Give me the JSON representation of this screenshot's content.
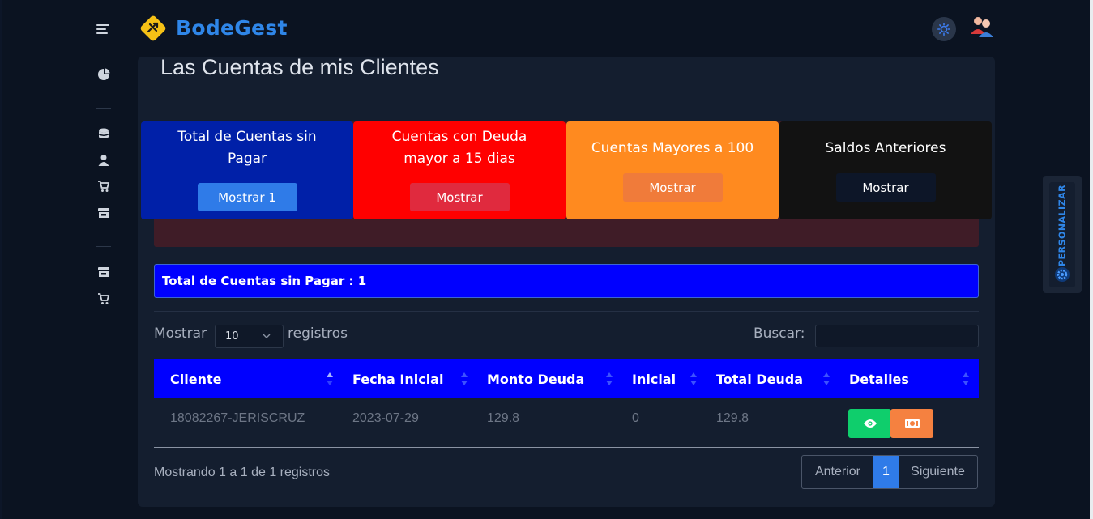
{
  "app": {
    "brand": "BodeGest"
  },
  "page": {
    "title": "Las Cuentas de mis Clientes"
  },
  "stats": [
    {
      "title": "Total de Cuentas sin Pagar",
      "button": "Mostrar 1",
      "bg": "#0020a8",
      "btn_bg": "#2f7be8"
    },
    {
      "title": "Cuentas con Deuda mayor a 15 dias",
      "button": "Mostrar",
      "bg": "#ff0000",
      "btn_bg": "#e02a3e"
    },
    {
      "title": "Cuentas Mayores a 100",
      "button": "Mostrar",
      "bg": "#ff8a1f",
      "btn_bg": "#f07b3a"
    },
    {
      "title": "Saldos Anteriores",
      "button": "Mostrar",
      "bg": "#121212",
      "btn_bg": "#0d1628"
    }
  ],
  "banner": {
    "text": "Total de Cuentas sin Pagar : 1"
  },
  "table_controls": {
    "show_label": "Mostrar",
    "page_length": "10",
    "records_label": "registros",
    "search_label": "Buscar:"
  },
  "table": {
    "headers": [
      "Cliente",
      "Fecha Inicial",
      "Monto Deuda",
      "Inicial",
      "Total Deuda",
      "Detalles"
    ],
    "rows": [
      {
        "cliente": "18082267-JERISCRUZ",
        "fecha": "2023-07-29",
        "monto": "129.8",
        "inicial": "0",
        "total": "129.8"
      }
    ]
  },
  "footer": {
    "info": "Mostrando 1 a 1 de 1 registros",
    "prev": "Anterior",
    "page": "1",
    "next": "Siguiente"
  },
  "side_panel": {
    "label": "PERSONALIZAR"
  },
  "colors": {
    "accent": "#2f86e8",
    "table_header": "#0000ff",
    "view_button": "#0fce6c",
    "pay_button": "#f58140"
  }
}
